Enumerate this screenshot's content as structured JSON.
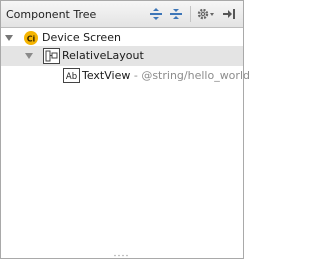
{
  "panel": {
    "title": "Component Tree",
    "toolbar": {
      "expand_all_icon": "expand-all-icon",
      "collapse_all_icon": "collapse-all-icon",
      "settings_icon": "gear-icon",
      "hide_icon": "hide-panel-icon"
    }
  },
  "tree": {
    "device": {
      "icon": "device-icon",
      "icon_text": "Ci",
      "label": "Device Screen"
    },
    "layout": {
      "icon": "relative-layout-icon",
      "label": "RelativeLayout"
    },
    "textview": {
      "icon": "textview-icon",
      "icon_text": "Ab",
      "label": "TextView",
      "detail": "- @string/hello_world"
    }
  },
  "colors": {
    "selected_row": "#e4e4e4",
    "device_icon": "#f5b400",
    "header_gradient_top": "#f6f6f6",
    "header_gradient_bottom": "#e3e3e3"
  }
}
